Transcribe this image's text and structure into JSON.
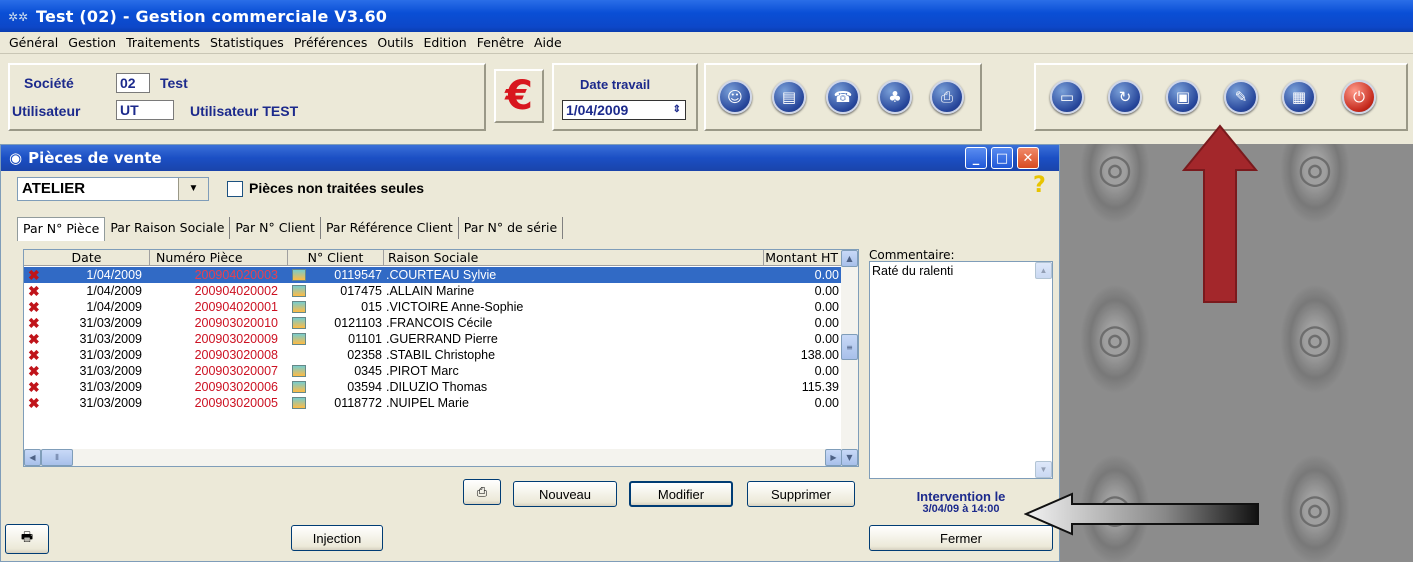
{
  "app": {
    "title": "Test (02) - Gestion commerciale V3.60"
  },
  "menu": [
    "Général",
    "Gestion",
    "Traitements",
    "Statistiques",
    "Préférences",
    "Outils",
    "Edition",
    "Fenêtre",
    "Aide"
  ],
  "header": {
    "societe_label": "Société",
    "societe_code": "02",
    "societe_name": "Test",
    "user_label": "Utilisateur",
    "user_code": "UT",
    "user_name": "Utilisateur TEST",
    "currency_symbol": "€",
    "date_label": "Date travail",
    "date_value": "1/04/2009"
  },
  "toolbar_icons": [
    "users-icon",
    "document-icon",
    "phone-icon",
    "team-icon",
    "print-icon",
    "monitor-icon",
    "refresh-icon",
    "bookmark-icon",
    "notes-icon",
    "calculator-icon",
    "power-icon"
  ],
  "window": {
    "title": "Pièces de vente"
  },
  "filter": {
    "combo_value": "ATELIER",
    "checkbox_label": "Pièces non traitées seules",
    "checked": false
  },
  "tabs": [
    "Par N° Pièce",
    "Par Raison Sociale",
    "Par N° Client",
    "Par Référence Client",
    "Par N° de série"
  ],
  "table": {
    "columns": [
      "Date",
      "Numéro Pièce",
      "N° Client",
      "Raison Sociale",
      "Montant HT"
    ],
    "rows": [
      {
        "date": "1/04/2009",
        "piece": "200904020003",
        "client": "0119547",
        "raison": ".COURTEAU Sylvie",
        "montant": "0.00",
        "selected": true
      },
      {
        "date": "1/04/2009",
        "piece": "200904020002",
        "client": "017475",
        "raison": ".ALLAIN Marine",
        "montant": "0.00"
      },
      {
        "date": "1/04/2009",
        "piece": "200904020001",
        "client": "015",
        "raison": ".VICTOIRE Anne-Sophie",
        "montant": "0.00"
      },
      {
        "date": "31/03/2009",
        "piece": "200903020010",
        "client": "0121103",
        "raison": ".FRANCOIS Cécile",
        "montant": "0.00"
      },
      {
        "date": "31/03/2009",
        "piece": "200903020009",
        "client": "01101",
        "raison": ".GUERRAND Pierre",
        "montant": "0.00"
      },
      {
        "date": "31/03/2009",
        "piece": "200903020008",
        "client": "02358",
        "raison": ".STABIL Christophe",
        "montant": "138.00"
      },
      {
        "date": "31/03/2009",
        "piece": "200903020007",
        "client": "0345",
        "raison": ".PIROT Marc",
        "montant": "0.00"
      },
      {
        "date": "31/03/2009",
        "piece": "200903020006",
        "client": "03594",
        "raison": ".DILUZIO Thomas",
        "montant": "115.39"
      },
      {
        "date": "31/03/2009",
        "piece": "200903020005",
        "client": "0118772",
        "raison": ".NUIPEL Marie",
        "montant": "0.00"
      }
    ]
  },
  "buttons": {
    "nouveau": "Nouveau",
    "modifier": "Modifier",
    "supprimer": "Supprimer",
    "injection": "Injection",
    "fermer": "Fermer"
  },
  "comment": {
    "label": "Commentaire:",
    "text": "Raté du ralenti"
  },
  "intervention": {
    "line1": "Intervention le",
    "line2": "3/04/09 à 14:00"
  },
  "colors": {
    "accent_red_piece": "#cc1122",
    "selection": "#316ac5",
    "label_blue": "#1c2a8c"
  }
}
